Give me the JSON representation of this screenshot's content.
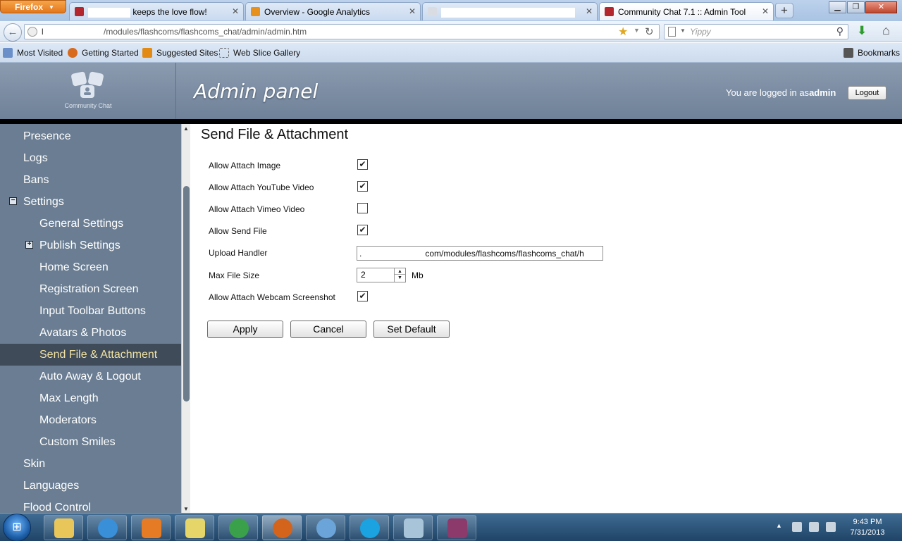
{
  "browser": {
    "menu_button": "Firefox",
    "tabs": [
      {
        "title": "keeps the love flow!",
        "active": false
      },
      {
        "title": "Overview - Google Analytics",
        "active": false
      },
      {
        "title": "",
        "active": false
      },
      {
        "title": "Community Chat 7.1 :: Admin Tool",
        "active": true
      }
    ],
    "new_tab": "+",
    "url_start": "l",
    "url": "/modules/flashcoms/flashcoms_chat/admin/admin.htm",
    "search_placeholder": "Yippy",
    "bookmarks": [
      "Most Visited",
      "Getting Started",
      "Suggested Sites",
      "Web Slice Gallery"
    ],
    "bookmarks_menu": "Bookmarks"
  },
  "header": {
    "logo_text": "Community Chat",
    "title": "Admin panel",
    "logged_in_prefix": "You are logged in as",
    "username": "admin",
    "logout_label": "Logout"
  },
  "sidebar": {
    "items": [
      {
        "label": "Presence"
      },
      {
        "label": "Logs"
      },
      {
        "label": "Bans"
      },
      {
        "label": "Settings",
        "tree": "−"
      },
      {
        "label": "General Settings"
      },
      {
        "label": "Publish Settings",
        "tree": "+"
      },
      {
        "label": "Home Screen"
      },
      {
        "label": "Registration Screen"
      },
      {
        "label": "Input Toolbar Buttons"
      },
      {
        "label": "Avatars & Photos"
      },
      {
        "label": "Send File & Attachment",
        "selected": true
      },
      {
        "label": "Auto Away & Logout"
      },
      {
        "label": "Max Length"
      },
      {
        "label": "Moderators"
      },
      {
        "label": "Custom Smiles"
      },
      {
        "label": "Skin"
      },
      {
        "label": "Languages"
      },
      {
        "label": "Flood Control"
      }
    ]
  },
  "content": {
    "title": "Send File & Attachment",
    "fields": {
      "attach_image": {
        "label": "Allow Attach Image",
        "checked": true
      },
      "attach_youtube": {
        "label": "Allow Attach YouTube Video",
        "checked": true
      },
      "attach_vimeo": {
        "label": "Allow Attach Vimeo Video",
        "checked": false
      },
      "send_file": {
        "label": "Allow Send File",
        "checked": true
      },
      "upload_handler": {
        "label": "Upload Handler",
        "value_start": ".",
        "value": "com/modules/flashcoms/flashcoms_chat/h"
      },
      "max_file_size": {
        "label": "Max File Size",
        "value": "2",
        "unit": "Mb"
      },
      "webcam_screenshot": {
        "label": "Allow Attach Webcam Screenshot",
        "checked": true
      }
    },
    "buttons": {
      "apply": "Apply",
      "cancel": "Cancel",
      "set_default": "Set Default"
    }
  },
  "taskbar": {
    "time": "9:43 PM",
    "date": "7/31/2013"
  },
  "colors": {
    "sidebar_bg": "#6a7d92",
    "sidebar_selected_bg": "#3f4b58",
    "sidebar_selected_text": "#f0e2a4",
    "header_bg": "#7b8ca2"
  }
}
